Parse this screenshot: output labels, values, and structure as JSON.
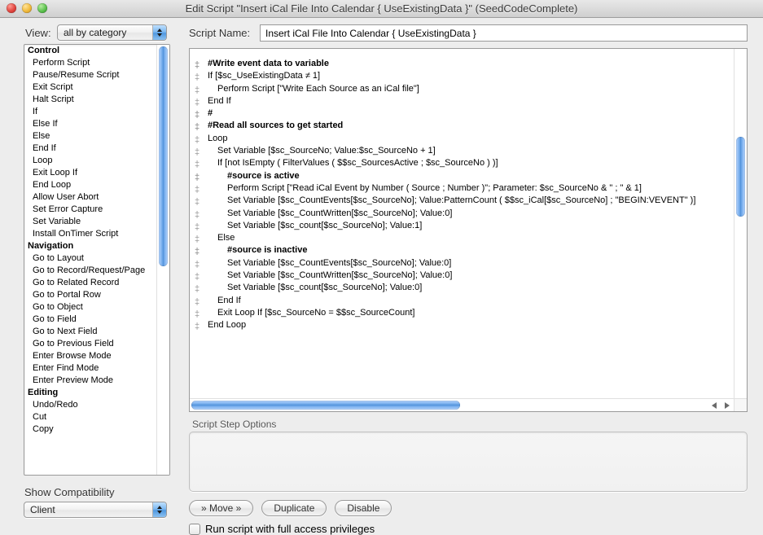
{
  "window": {
    "title": "Edit Script \"Insert iCal File Into Calendar { UseExistingData }\" (SeedCodeComplete)"
  },
  "view": {
    "label": "View:",
    "value": "all by category"
  },
  "compat": {
    "label": "Show Compatibility",
    "value": "Client"
  },
  "script_name": {
    "label": "Script Name:",
    "value": "Insert iCal File Into Calendar { UseExistingData }"
  },
  "sidebar": {
    "groups": [
      {
        "title": "Control",
        "items": [
          "Perform Script",
          "Pause/Resume Script",
          "Exit Script",
          "Halt Script",
          "If",
          "Else If",
          "Else",
          "End If",
          "Loop",
          "Exit Loop If",
          "End Loop",
          "Allow User Abort",
          "Set Error Capture",
          "Set Variable",
          "Install OnTimer Script"
        ]
      },
      {
        "title": "Navigation",
        "items": [
          "Go to Layout",
          "Go to Record/Request/Page",
          "Go to Related Record",
          "Go to Portal Row",
          "Go to Object",
          "Go to Field",
          "Go to Next Field",
          "Go to Previous Field",
          "Enter Browse Mode",
          "Enter Find Mode",
          "Enter Preview Mode"
        ]
      },
      {
        "title": "Editing",
        "items": [
          "Undo/Redo",
          "Cut",
          "Copy"
        ]
      }
    ]
  },
  "script_lines": [
    {
      "text": "#Write event data to variable",
      "bold": true,
      "indent": 0
    },
    {
      "text": "If [$sc_UseExistingData ≠ 1]",
      "bold": false,
      "indent": 0
    },
    {
      "text": "Perform Script [\"Write Each Source as an iCal file\"]",
      "bold": false,
      "indent": 1
    },
    {
      "text": "End If",
      "bold": false,
      "indent": 0
    },
    {
      "text": "#",
      "bold": true,
      "indent": 0
    },
    {
      "text": "#Read all sources to get started",
      "bold": true,
      "indent": 0
    },
    {
      "text": "Loop",
      "bold": false,
      "indent": 0
    },
    {
      "text": "Set Variable [$sc_SourceNo; Value:$sc_SourceNo + 1]",
      "bold": false,
      "indent": 1
    },
    {
      "text": "If [not IsEmpty ( FilterValues ( $$sc_SourcesActive ; $sc_SourceNo ) )]",
      "bold": false,
      "indent": 1
    },
    {
      "text": "#source is active",
      "bold": true,
      "indent": 2
    },
    {
      "text": "Perform Script [\"Read iCal Event by Number ( Source ; Number )\"; Parameter: $sc_SourceNo & \" ; \" & 1]",
      "bold": false,
      "indent": 2
    },
    {
      "text": "Set Variable [$sc_CountEvents[$sc_SourceNo]; Value:PatternCount ( $$sc_iCal[$sc_SourceNo] ; \"BEGIN:VEVENT\" )]",
      "bold": false,
      "indent": 2
    },
    {
      "text": "Set Variable [$sc_CountWritten[$sc_SourceNo]; Value:0]",
      "bold": false,
      "indent": 2
    },
    {
      "text": "Set Variable [$sc_count[$sc_SourceNo]; Value:1]",
      "bold": false,
      "indent": 2
    },
    {
      "text": "Else",
      "bold": false,
      "indent": 1
    },
    {
      "text": "#source is inactive",
      "bold": true,
      "indent": 2
    },
    {
      "text": "Set Variable [$sc_CountEvents[$sc_SourceNo]; Value:0]",
      "bold": false,
      "indent": 2
    },
    {
      "text": "Set Variable [$sc_CountWritten[$sc_SourceNo]; Value:0]",
      "bold": false,
      "indent": 2
    },
    {
      "text": "Set Variable [$sc_count[$sc_SourceNo]; Value:0]",
      "bold": false,
      "indent": 2
    },
    {
      "text": "End If",
      "bold": false,
      "indent": 1
    },
    {
      "text": "Exit Loop If [$sc_SourceNo = $$sc_SourceCount]",
      "bold": false,
      "indent": 1
    },
    {
      "text": "End Loop",
      "bold": false,
      "indent": 0
    }
  ],
  "options": {
    "header": "Script Step Options"
  },
  "buttons": {
    "move": "» Move »",
    "duplicate": "Duplicate",
    "disable": "Disable"
  },
  "checkbox": {
    "full_access": "Run script with full access privileges"
  }
}
